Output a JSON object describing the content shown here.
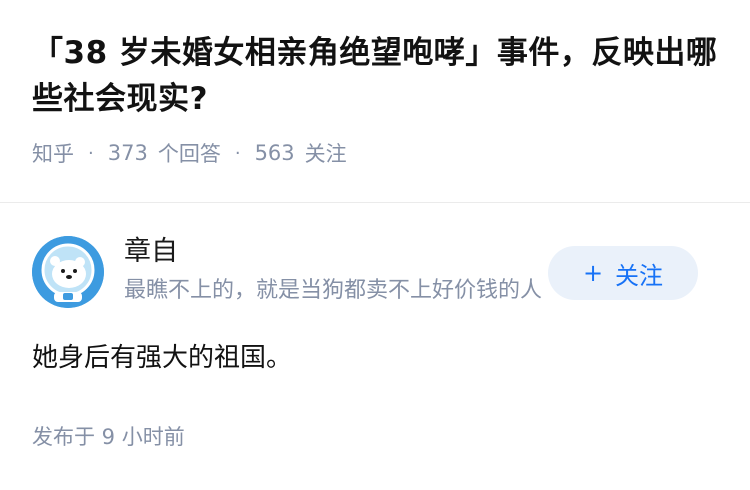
{
  "question": {
    "title": "「38 岁未婚女相亲角绝望咆哮」事件，反映出哪些社会现实?",
    "source": "知乎",
    "answer_count": "373",
    "answer_label": "个回答",
    "follower_count": "563",
    "follower_label": "关注"
  },
  "answer": {
    "author": {
      "name": "章自",
      "bio": "最瞧不上的，就是当狗都卖不上好价钱的人",
      "avatar_icon": "polar-bear-astronaut-avatar"
    },
    "follow_button": {
      "icon": "plus-icon",
      "label": "关注"
    },
    "content": "她身后有强大的祖国。",
    "publish_time": "发布于 9 小时前"
  },
  "colors": {
    "meta_gray": "#8590a6",
    "accent_blue": "#1772f6",
    "button_bg": "#eaf1fa"
  }
}
